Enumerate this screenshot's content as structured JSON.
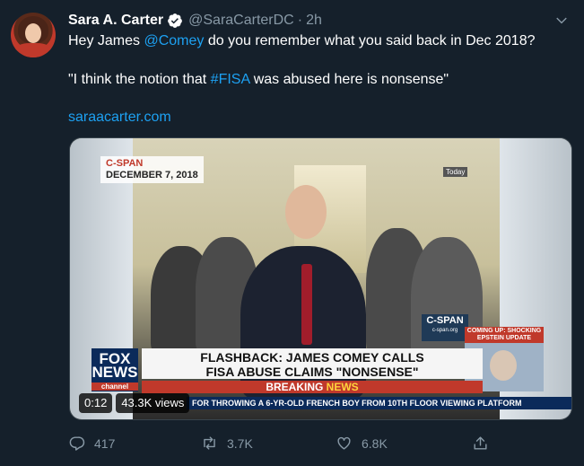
{
  "author": {
    "name": "Sara A. Carter",
    "handle": "@SaraCarterDC",
    "separator": "·",
    "time": "2h"
  },
  "tweet": {
    "line1_pre": "Hey James ",
    "line1_mention": "@Comey",
    "line1_post": " do you remember what you said back in Dec 2018?",
    "line2_pre": "\"I think the notion that ",
    "line2_hashtag": "#FISA",
    "line2_post": " was abused here is nonsense\"",
    "link": "saraacarter.com"
  },
  "media": {
    "cspan_top_brand": "C-SPAN",
    "cspan_top_date": "DECEMBER 7, 2018",
    "today": "Today",
    "cspan_right": "C-SPAN",
    "cspan_right_sub": "c-span.org",
    "fox_line1": "FOX",
    "fox_line2": "NEWS",
    "fox_channel": "channel",
    "headline_1": "FLASHBACK: JAMES COMEY CALLS",
    "headline_2": "FISA ABUSE CLAIMS \"NONSENSE\"",
    "breaking_1": "BREAKING ",
    "breaking_2": "NEWS",
    "ticker": "FOR THROWING A 6-YR-OLD FRENCH BOY FROM 10TH FLOOR VIEWING PLATFORM",
    "inset_label": "COMING UP: SHOCKING EPSTEIN UPDATE",
    "duration": "0:12",
    "views": "43.3K views"
  },
  "actions": {
    "replies": "417",
    "retweets": "3.7K",
    "likes": "6.8K"
  },
  "colors": {
    "background": "#15202b",
    "secondary_text": "#8899a6",
    "link": "#1da1f2"
  }
}
